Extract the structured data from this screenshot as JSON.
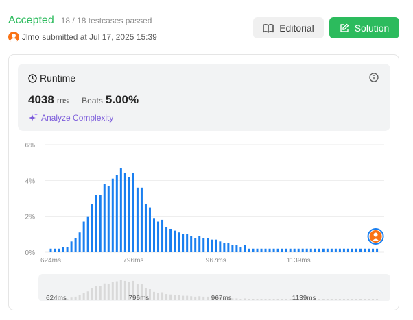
{
  "header": {
    "status": "Accepted",
    "testcases": "18 / 18 testcases passed",
    "user": "Jlmo",
    "submitted_text": "submitted at Jul 17, 2025 15:39",
    "editorial_label": "Editorial",
    "solution_label": "Solution"
  },
  "runtime": {
    "title": "Runtime",
    "value": "4038",
    "unit": "ms",
    "beats_label": "Beats",
    "beats_value": "5.00%",
    "analyze_label": "Analyze Complexity"
  },
  "colors": {
    "accent_green": "#2cbb5d",
    "bar_blue": "#1a7ff0",
    "analyze_purple": "#7c5cdb",
    "overview_bar": "#d9d9d9"
  },
  "chart_data": {
    "type": "bar",
    "xlabel": "",
    "ylabel": "",
    "y_ticks": [
      "0%",
      "2%",
      "4%",
      "6%"
    ],
    "ylim": [
      0,
      6
    ],
    "x_ticks": [
      {
        "index": 0,
        "label": "624ms"
      },
      {
        "index": 20,
        "label": "796ms"
      },
      {
        "index": 40,
        "label": "967ms"
      },
      {
        "index": 60,
        "label": "1139ms"
      }
    ],
    "values": [
      0.2,
      0.2,
      0.2,
      0.3,
      0.3,
      0.6,
      0.8,
      1.1,
      1.7,
      2.0,
      2.7,
      3.2,
      3.2,
      3.8,
      3.7,
      4.1,
      4.3,
      4.7,
      4.4,
      4.2,
      4.4,
      3.6,
      3.6,
      2.7,
      2.5,
      1.9,
      1.7,
      1.8,
      1.4,
      1.3,
      1.2,
      1.1,
      1.0,
      1.0,
      0.9,
      0.8,
      0.9,
      0.8,
      0.8,
      0.7,
      0.7,
      0.6,
      0.5,
      0.5,
      0.4,
      0.4,
      0.3,
      0.4,
      0.2,
      0.2,
      0.2,
      0.2,
      0.2,
      0.2,
      0.2,
      0.2,
      0.2,
      0.2,
      0.2,
      0.2,
      0.2,
      0.2,
      0.2,
      0.2,
      0.2,
      0.2,
      0.2,
      0.2,
      0.2,
      0.2,
      0.2,
      0.2,
      0.2,
      0.2,
      0.2,
      0.2,
      0.2,
      0.2,
      0.2,
      0.2
    ],
    "highlight_index": 79,
    "grid": true
  }
}
